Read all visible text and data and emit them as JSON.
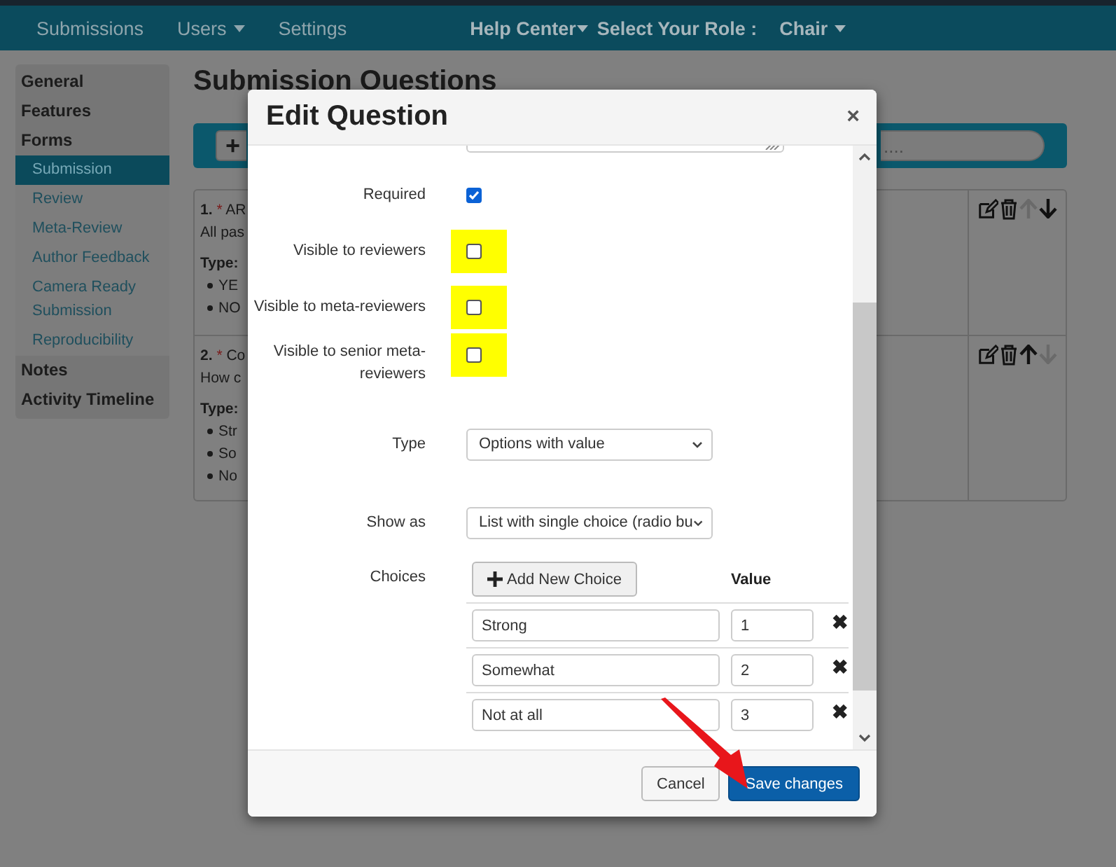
{
  "navbar": {
    "items": [
      {
        "label": "Submissions",
        "dropdown": false
      },
      {
        "label": "Users",
        "dropdown": true
      },
      {
        "label": "Settings",
        "dropdown": false
      }
    ],
    "help": {
      "label": "Help Center",
      "dropdown": true
    },
    "role_label": "Select Your Role :",
    "role": {
      "label": "Chair",
      "dropdown": true
    }
  },
  "sidebar": {
    "items": [
      {
        "label": "General"
      },
      {
        "label": "Features"
      },
      {
        "label": "Forms",
        "children": [
          {
            "label": "Submission",
            "selected": true
          },
          {
            "label": "Review",
            "selected": false
          },
          {
            "label": "Meta-Review",
            "selected": false
          },
          {
            "label": "Author Feedback",
            "selected": false
          },
          {
            "label": "Camera Ready Submission",
            "selected": false
          },
          {
            "label": "Reproducibility",
            "selected": false
          }
        ]
      },
      {
        "label": "Notes"
      },
      {
        "label": "Activity Timeline"
      }
    ]
  },
  "page": {
    "title": "Submission Questions",
    "add_button": "+",
    "search": {
      "placeholder": "...."
    },
    "questions": [
      {
        "number": "1.",
        "required_mark": "*",
        "title": "AR",
        "text": "All pas",
        "type_label": "Type:",
        "options": [
          "YE",
          "NO"
        ],
        "can_move_up": false,
        "can_move_down": true
      },
      {
        "number": "2.",
        "required_mark": "*",
        "title": "Co",
        "text": "How c",
        "type_label": "Type:",
        "options": [
          "Str",
          "So",
          "No"
        ],
        "can_move_up": true,
        "can_move_down": false
      }
    ]
  },
  "dialog": {
    "title": "Edit Question",
    "close": "×",
    "fields": [
      {
        "kind": "textarea"
      },
      {
        "kind": "checkbox",
        "label": "Required",
        "checked": true,
        "highlighted": false
      },
      {
        "kind": "checkbox",
        "label": "Visible to reviewers",
        "checked": false,
        "highlighted": true
      },
      {
        "kind": "checkbox",
        "label": "Visible to meta-reviewers",
        "checked": false,
        "highlighted": true
      },
      {
        "kind": "checkbox",
        "label": "Visible to senior meta-reviewers",
        "checked": false,
        "highlighted": true
      },
      {
        "kind": "select",
        "label": "Type",
        "value": "Options with value"
      },
      {
        "kind": "select",
        "label": "Show as",
        "value": "List with single choice (radio bu"
      },
      {
        "kind": "choices",
        "label": "Choices",
        "button": "Add New Choice",
        "value_heading": "Value",
        "remove": "✖",
        "rows": [
          {
            "text": "Strong",
            "value": "1"
          },
          {
            "text": "Somewhat",
            "value": "2"
          },
          {
            "text": "Not at all",
            "value": "3"
          }
        ]
      }
    ],
    "buttons": [
      {
        "label": "Cancel",
        "kind": "default"
      },
      {
        "label": "Save changes",
        "kind": "primary"
      }
    ]
  },
  "annotations": [
    {
      "kind": "arrow"
    }
  ]
}
